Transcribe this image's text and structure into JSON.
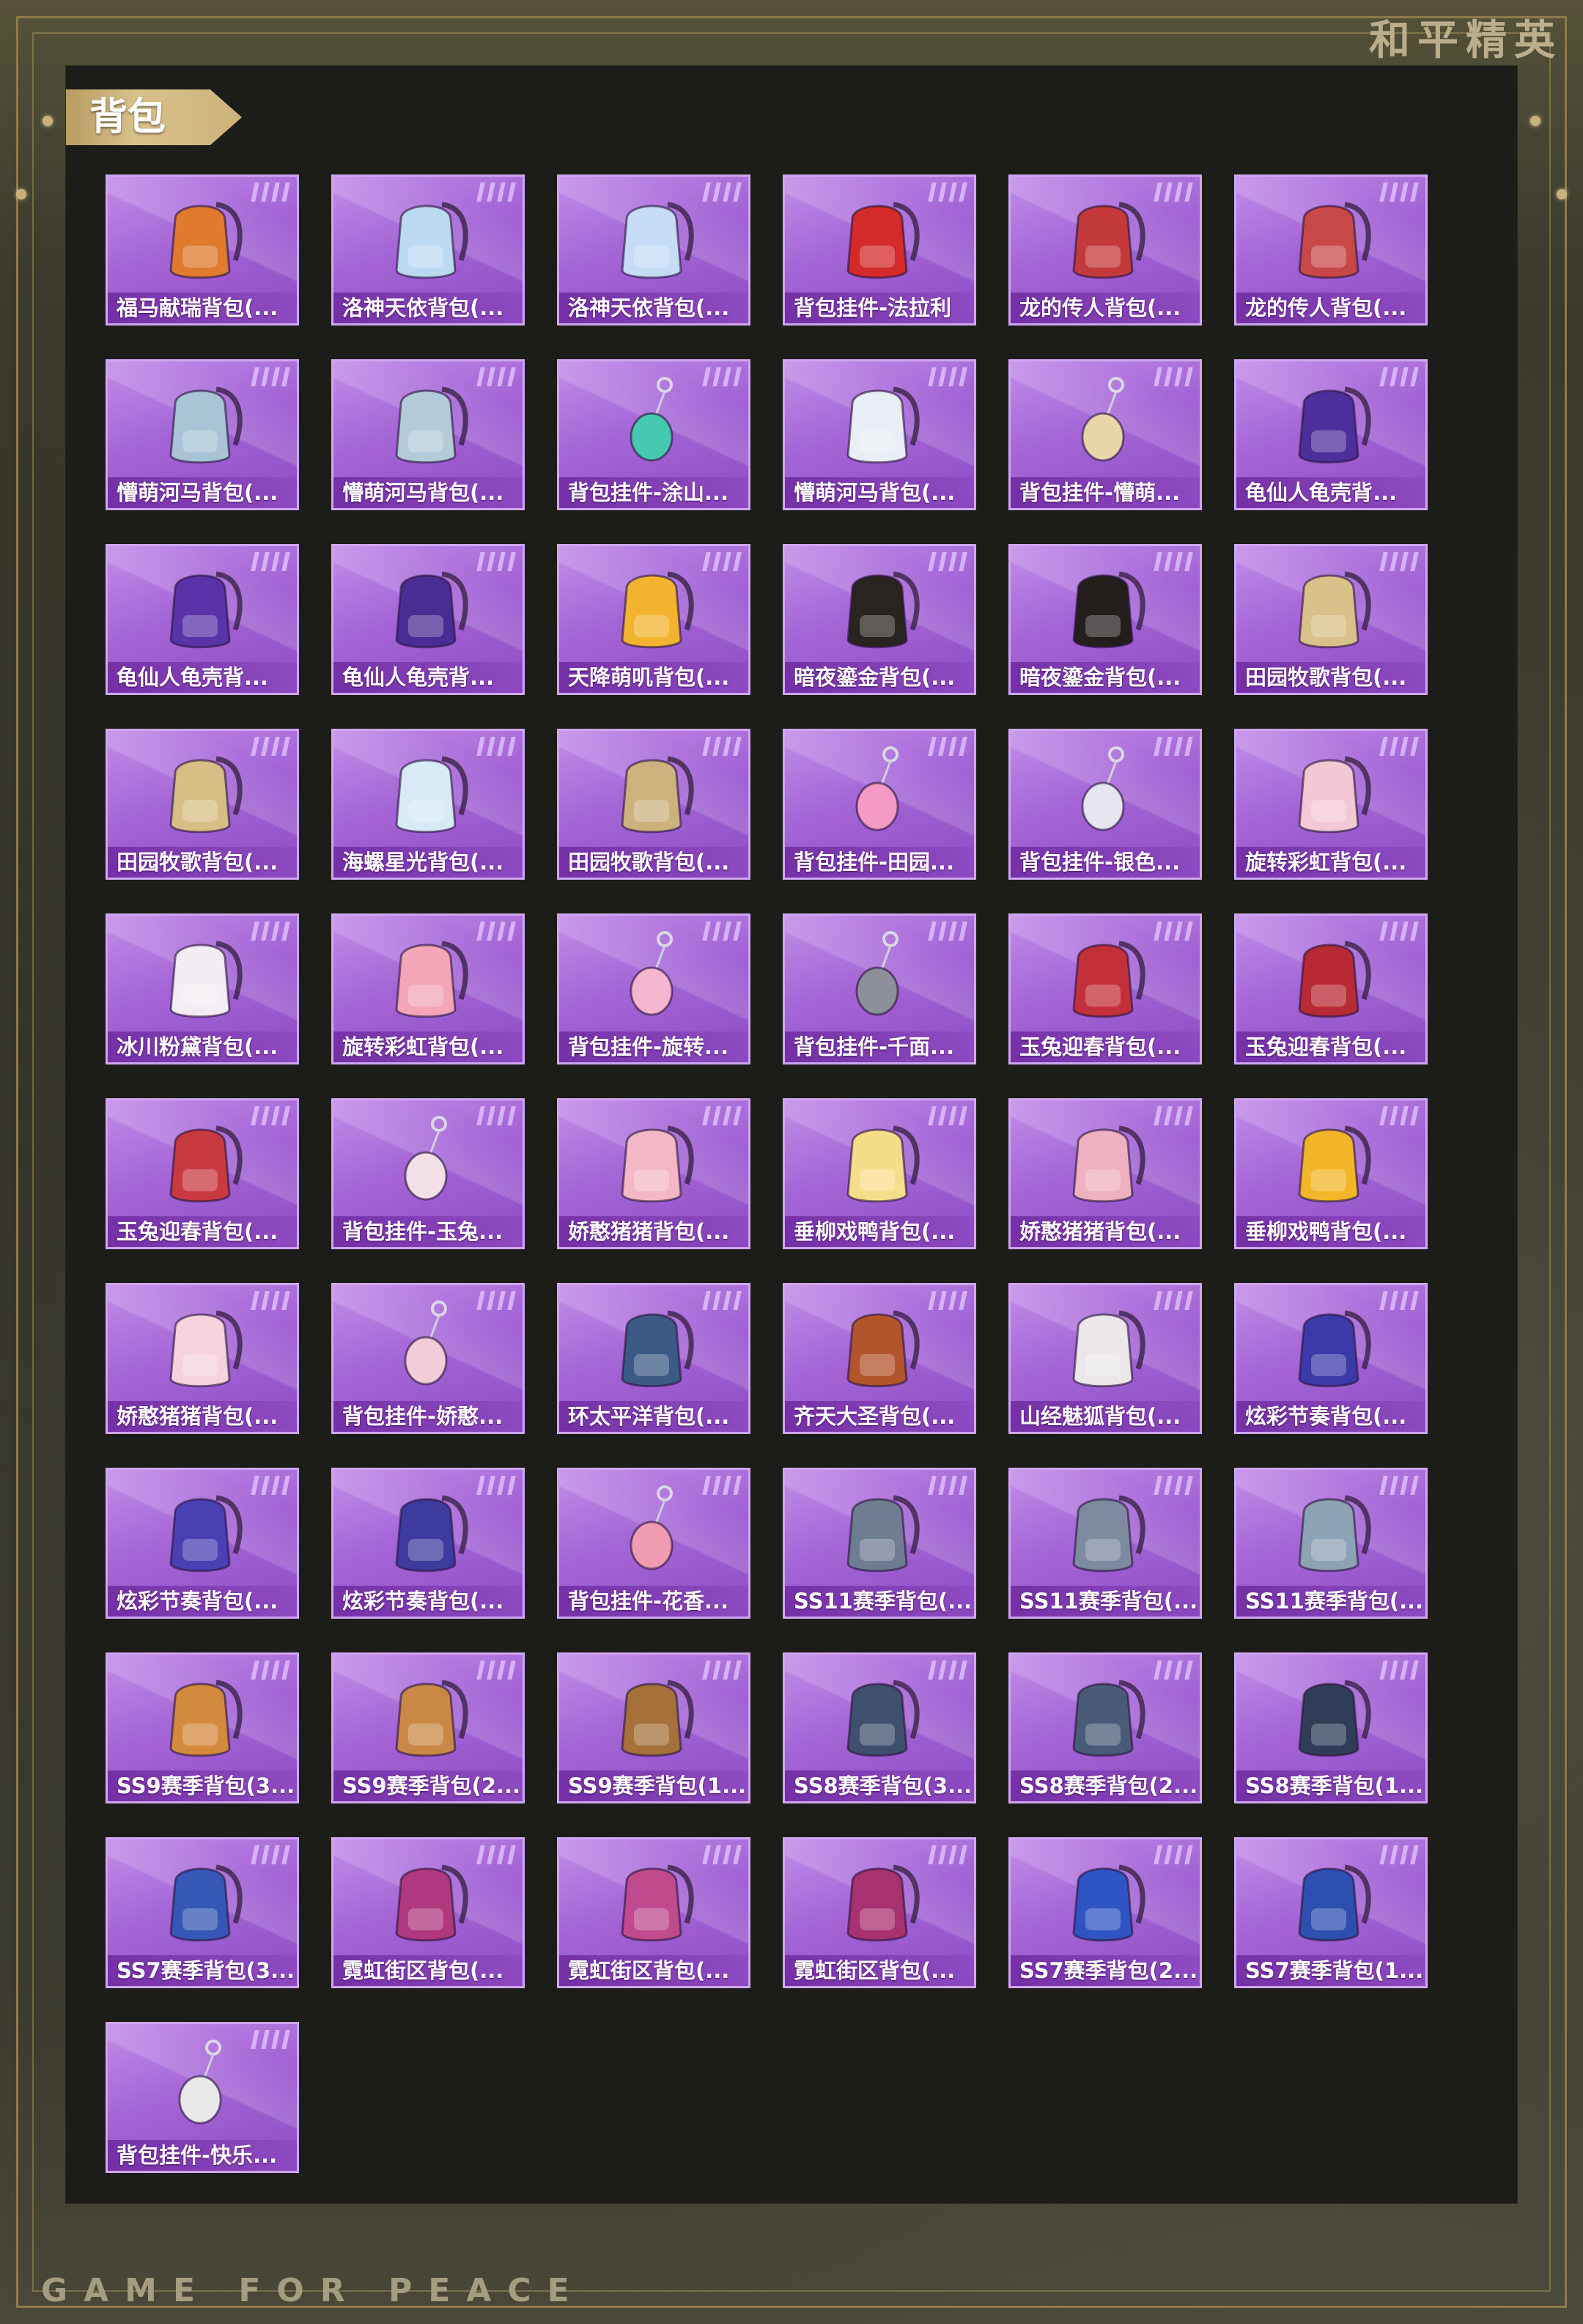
{
  "brand": {
    "chinese": "和平精英",
    "english": "GAME FOR PEACE"
  },
  "section": {
    "title": "背包"
  },
  "items": [
    {
      "label": "福马献瑞背包(...",
      "icon": "orange-horse-backpack-icon",
      "color": "#e07a2c"
    },
    {
      "label": "洛神天依背包(...",
      "icon": "white-blue-ornate-backpack-icon",
      "color": "#bcd9f2"
    },
    {
      "label": "洛神天依背包(...",
      "icon": "white-blue-ornate-backpack-icon",
      "color": "#c6dcf5"
    },
    {
      "label": "背包挂件-法拉利",
      "icon": "ferrari-keychain-icon",
      "color": "#d42a2a"
    },
    {
      "label": "龙的传人背包(...",
      "icon": "red-white-backpack-icon",
      "color": "#c43a3a"
    },
    {
      "label": "龙的传人背包(...",
      "icon": "red-white-backpack-icon",
      "color": "#c84848"
    },
    {
      "label": "懵萌河马背包(...",
      "icon": "hippo-backpack-icon",
      "color": "#a9c4d6"
    },
    {
      "label": "懵萌河马背包(...",
      "icon": "hippo-backpack-icon",
      "color": "#b3cbd9"
    },
    {
      "label": "背包挂件-涂山...",
      "icon": "teal-fan-charm-icon",
      "color": "#46c9b0"
    },
    {
      "label": "懵萌河马背包(...",
      "icon": "white-bunny-backpack-icon",
      "color": "#e9eef4"
    },
    {
      "label": "背包挂件-懵萌...",
      "icon": "feather-charm-icon",
      "color": "#e8d6a8"
    },
    {
      "label": "龟仙人龟壳背...",
      "icon": "purple-shell-backpack-icon",
      "color": "#4d2f9c"
    },
    {
      "label": "龟仙人龟壳背...",
      "icon": "purple-shell-backpack-icon",
      "color": "#5a33a8"
    },
    {
      "label": "龟仙人龟壳背...",
      "icon": "purple-shell-backpack-icon",
      "color": "#4a2d93"
    },
    {
      "label": "天降萌叽背包(...",
      "icon": "yellow-chick-backpack-icon",
      "color": "#f2b430"
    },
    {
      "label": "暗夜鎏金背包(...",
      "icon": "black-gold-backpack-icon",
      "color": "#2a2420"
    },
    {
      "label": "暗夜鎏金背包(...",
      "icon": "black-gold-backpack-icon",
      "color": "#231e1c"
    },
    {
      "label": "田园牧歌背包(...",
      "icon": "flower-basket-backpack-icon",
      "color": "#d8c28a"
    },
    {
      "label": "田园牧歌背包(...",
      "icon": "flower-basket-backpack-icon",
      "color": "#d6bf84"
    },
    {
      "label": "海螺星光背包(...",
      "icon": "shell-pouch-backpack-icon",
      "color": "#d7eaf6"
    },
    {
      "label": "田园牧歌背包(...",
      "icon": "woven-basket-backpack-icon",
      "color": "#cdb27e"
    },
    {
      "label": "背包挂件-田园...",
      "icon": "pink-card-charm-icon",
      "color": "#f59ac4"
    },
    {
      "label": "背包挂件-银色...",
      "icon": "silver-badge-charm-icon",
      "color": "#e6e6f0"
    },
    {
      "label": "旋转彩虹背包(...",
      "icon": "pink-cake-backpack-icon",
      "color": "#f3c8d4"
    },
    {
      "label": "冰川粉黛背包(...",
      "icon": "white-heart-bunny-backpack-icon",
      "color": "#f3ecf2"
    },
    {
      "label": "旋转彩虹背包(...",
      "icon": "pink-dress-backpack-icon",
      "color": "#f2a6b8"
    },
    {
      "label": "背包挂件-旋转...",
      "icon": "unicorn-charm-icon",
      "color": "#f7b6cf"
    },
    {
      "label": "背包挂件-千面...",
      "icon": "disco-ball-charm-icon",
      "color": "#8d8f9b"
    },
    {
      "label": "玉兔迎春背包(...",
      "icon": "red-white-backpack-icon",
      "color": "#c4303a"
    },
    {
      "label": "玉兔迎春背包(...",
      "icon": "red-white-backpack-icon",
      "color": "#b82a34"
    },
    {
      "label": "玉兔迎春背包(...",
      "icon": "red-white-backpack-icon",
      "color": "#c93a40"
    },
    {
      "label": "背包挂件-玉兔...",
      "icon": "bunny-charm-icon",
      "color": "#f3dfe6"
    },
    {
      "label": "娇憨猪猪背包(...",
      "icon": "pink-pig-backpack-icon",
      "color": "#f3b7c6"
    },
    {
      "label": "垂柳戏鸭背包(...",
      "icon": "yellow-bunny-backpack-icon",
      "color": "#f6dd8a"
    },
    {
      "label": "娇憨猪猪背包(...",
      "icon": "pink-pig-backpack-icon",
      "color": "#efb0c0"
    },
    {
      "label": "垂柳戏鸭背包(...",
      "icon": "yellow-duck-backpack-icon",
      "color": "#f2b628"
    },
    {
      "label": "娇憨猪猪背包(...",
      "icon": "pink-bunny-backpack-icon",
      "color": "#f5d2dc"
    },
    {
      "label": "背包挂件-娇憨...",
      "icon": "pig-charm-icon",
      "color": "#f2ccd8"
    },
    {
      "label": "环太平洋背包(...",
      "icon": "mech-backpack-icon",
      "color": "#3c5a86"
    },
    {
      "label": "齐天大圣背包(...",
      "icon": "monkey-king-backpack-icon",
      "color": "#b3552c"
    },
    {
      "label": "山经魅狐背包(...",
      "icon": "white-fox-backpack-icon",
      "color": "#ece8ea"
    },
    {
      "label": "炫彩节奏背包(...",
      "icon": "graffiti-backpack-icon",
      "color": "#3c3aa8"
    },
    {
      "label": "炫彩节奏背包(...",
      "icon": "graffiti-backpack-icon",
      "color": "#4a3fb3"
    },
    {
      "label": "炫彩节奏背包(...",
      "icon": "graffiti-backpack-icon",
      "color": "#3e3b9e"
    },
    {
      "label": "背包挂件-花香...",
      "icon": "perfume-charm-icon",
      "color": "#f09cb3"
    },
    {
      "label": "SS11赛季背包(...",
      "icon": "grey-tactical-backpack-icon",
      "color": "#6f7d92"
    },
    {
      "label": "SS11赛季背包(...",
      "icon": "grey-tactical-backpack-icon",
      "color": "#7d8aa0"
    },
    {
      "label": "SS11赛季背包(...",
      "icon": "grey-tactical-backpack-icon",
      "color": "#8da2b4"
    },
    {
      "label": "SS9赛季背包(3...",
      "icon": "orange-tactical-backpack-icon",
      "color": "#d48a3c"
    },
    {
      "label": "SS9赛季背包(2...",
      "icon": "orange-tactical-backpack-icon",
      "color": "#c98846"
    },
    {
      "label": "SS9赛季背包(1...",
      "icon": "brown-tactical-backpack-icon",
      "color": "#a6703a"
    },
    {
      "label": "SS8赛季背包(3...",
      "icon": "navy-tactical-backpack-icon",
      "color": "#3f4f6e"
    },
    {
      "label": "SS8赛季背包(2...",
      "icon": "navy-tactical-backpack-icon",
      "color": "#4a5b79"
    },
    {
      "label": "SS8赛季背包(1...",
      "icon": "navy-tactical-backpack-icon",
      "color": "#2f3d58"
    },
    {
      "label": "SS7赛季背包(3...",
      "icon": "blue-graffiti-backpack-icon",
      "color": "#3557b5"
    },
    {
      "label": "霓虹街区背包(...",
      "icon": "magenta-backpack-icon",
      "color": "#b0387e"
    },
    {
      "label": "霓虹街区背包(...",
      "icon": "magenta-backpack-icon",
      "color": "#c04a8e"
    },
    {
      "label": "霓虹街区背包(...",
      "icon": "magenta-backpack-icon",
      "color": "#a8316f"
    },
    {
      "label": "SS7赛季背包(2...",
      "icon": "blue-graffiti-backpack-icon",
      "color": "#2f55c4"
    },
    {
      "label": "SS7赛季背包(1...",
      "icon": "blue-graffiti-backpack-icon",
      "color": "#2d4fb0"
    },
    {
      "label": "背包挂件-快乐...",
      "icon": "round-ball-charm-icon",
      "color": "#e9e9e9"
    }
  ]
}
